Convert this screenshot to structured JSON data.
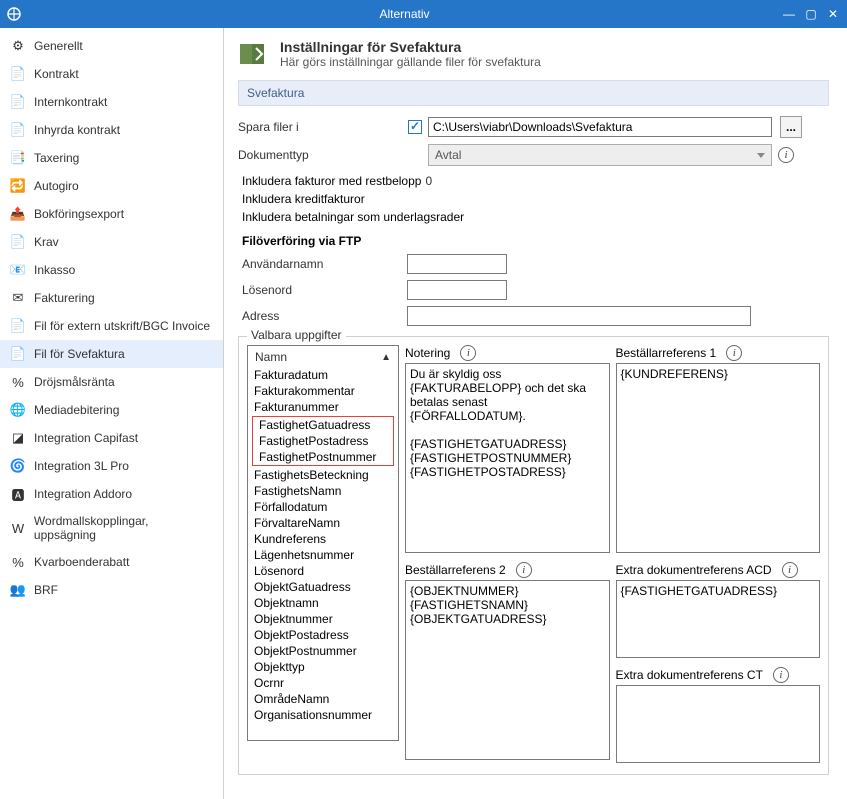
{
  "window": {
    "title": "Alternativ"
  },
  "sidebar": {
    "items": [
      {
        "label": "Generellt"
      },
      {
        "label": "Kontrakt"
      },
      {
        "label": "Internkontrakt"
      },
      {
        "label": "Inhyrda kontrakt"
      },
      {
        "label": "Taxering"
      },
      {
        "label": "Autogiro"
      },
      {
        "label": "Bokföringsexport"
      },
      {
        "label": "Krav"
      },
      {
        "label": "Inkasso"
      },
      {
        "label": "Fakturering"
      },
      {
        "label": "Fil för extern utskrift/BGC Invoice"
      },
      {
        "label": "Fil för Svefaktura"
      },
      {
        "label": "Dröjsmålsränta"
      },
      {
        "label": "Mediadebitering"
      },
      {
        "label": "Integration Capifast"
      },
      {
        "label": "Integration 3L Pro"
      },
      {
        "label": "Integration Addoro"
      },
      {
        "label": "Wordmallskopplingar, uppsägning"
      },
      {
        "label": "Kvarboenderabatt"
      },
      {
        "label": "BRF"
      }
    ],
    "selected_index": 11
  },
  "header": {
    "title": "Inställningar för Svefaktura",
    "subtitle": "Här görs inställningar gällande filer för svefaktura"
  },
  "section": {
    "label": "Svefaktura"
  },
  "form": {
    "spara_label": "Spara filer i",
    "spara_checked": true,
    "spara_path": "C:\\Users\\viabr\\Downloads\\Svefaktura",
    "browse": "...",
    "dokumenttyp_label": "Dokumenttyp",
    "dokumenttyp_value": "Avtal",
    "chk_restbelopp": "Inkludera fakturor med restbelopp",
    "chk_restbelopp_value": "0",
    "chk_kredit": "Inkludera kreditfakturor",
    "chk_betal": "Inkludera betalningar som underlagsrader"
  },
  "ftp": {
    "heading": "Filöverföring via FTP",
    "user_label": "Användarnamn",
    "pwd_label": "Lösenord",
    "adr_label": "Adress",
    "user": "",
    "pwd": "",
    "adr": ""
  },
  "valbara": {
    "legend": "Valbara uppgifter",
    "notering_label": "Notering",
    "bref1_label": "Beställarreferens 1",
    "bref2_label": "Beställarreferens 2",
    "extra_acd_label": "Extra dokumentreferens ACD",
    "extra_ct_label": "Extra dokumentreferens CT",
    "list_header": "Namn",
    "items": [
      "Fakturadatum",
      "Fakturakommentar",
      "Fakturanummer",
      "FastighetGatuadress",
      "FastighetPostadress",
      "FastighetPostnummer",
      "FastighetsBeteckning",
      "FastighetsNamn",
      "Förfallodatum",
      "FörvaltareNamn",
      "Kundreferens",
      "Lägenhetsnummer",
      "Lösenord",
      "ObjektGatuadress",
      "Objektnamn",
      "Objektnummer",
      "ObjektPostadress",
      "ObjektPostnummer",
      "Objekttyp",
      "Ocrnr",
      "OmrådeNamn",
      "Organisationsnummer"
    ],
    "highlighted_start": 3,
    "highlighted_end": 5,
    "notering_text": "Du är skyldig oss {FAKTURABELOPP} och det ska betalas senast {FÖRFALLODATUM}.\n\n{FASTIGHETGATUADRESS}\n{FASTIGHETPOSTNUMMER}\n{FASTIGHETPOSTADRESS}",
    "bref1_text": "{KUNDREFERENS}",
    "bref2_text": "{OBJEKTNUMMER}\n{FASTIGHETSNAMN}\n{OBJEKTGATUADRESS}",
    "extra_acd_text": "{FASTIGHETGATUADRESS}",
    "extra_ct_text": ""
  }
}
